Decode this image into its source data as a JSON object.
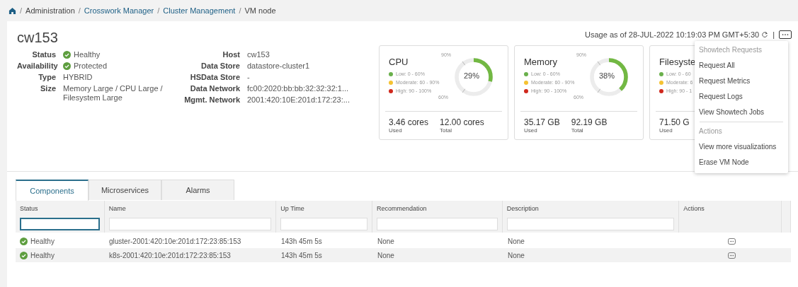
{
  "breadcrumb": [
    {
      "separator": "/",
      "label": "Administration",
      "kind": "text"
    },
    {
      "separator": "/",
      "label": "Crosswork Manager",
      "kind": "link"
    },
    {
      "separator": "/",
      "label": "Cluster Management",
      "kind": "link"
    },
    {
      "separator": "/",
      "label": "VM node",
      "kind": "text"
    }
  ],
  "title": "cw153",
  "usage": "Usage as of 28-JUL-2022 10:19:03 PM GMT+5:30",
  "separator": "|",
  "details_left": [
    {
      "label": "Status",
      "value": "Healthy",
      "kind": "status"
    },
    {
      "label": "Availability",
      "value": "Protected",
      "kind": "status"
    },
    {
      "label": "Type",
      "value": "HYBRID",
      "kind": "plain"
    },
    {
      "label": "Size",
      "value": "Memory Large / CPU Large / Filesystem Large",
      "kind": "plain"
    }
  ],
  "details_right": [
    {
      "label": "Host",
      "value": "cw153"
    },
    {
      "label": "Data Store",
      "value": "datastore-cluster1"
    },
    {
      "label": "HSData Store",
      "value": "-"
    },
    {
      "label": "Data Network",
      "value": "fc00:2020:bb:bb:32:32:32:1..."
    },
    {
      "label": "Mgmt. Network",
      "value": "2001:420:10E:201d:172:23:..."
    }
  ],
  "cards": [
    {
      "title": "CPU",
      "legend": [
        {
          "label": "Low: 0 - 60%",
          "color": "#6ab04c"
        },
        {
          "label": "Moderate: 60 - 90%",
          "color": "#f5c232"
        },
        {
          "label": "High: 90 - 100%",
          "color": "#d0281d"
        }
      ],
      "kind": "gauge",
      "level": 0.29,
      "percent": "29%",
      "tick_high": "90%",
      "tick_low": "60%",
      "used": "3.46 cores",
      "used_label": "Used",
      "total": "12.00 cores",
      "total_label": "Total"
    },
    {
      "title": "Memory",
      "legend": [
        {
          "label": "Low: 0 - 60%",
          "color": "#6ab04c"
        },
        {
          "label": "Moderate: 60 - 90%",
          "color": "#f5c232"
        },
        {
          "label": "High: 90 - 100%",
          "color": "#d0281d"
        }
      ],
      "kind": "gauge",
      "level": 0.38,
      "percent": "38%",
      "tick_high": "90%",
      "tick_low": "60%",
      "used": "35.17 GB",
      "used_label": "Used",
      "total": "92.19 GB",
      "total_label": "Total"
    },
    {
      "title": "Filesyste",
      "legend": [
        {
          "label": "Low: 0 - 60",
          "color": "#6ab04c"
        },
        {
          "label": "Moderate: 6",
          "color": "#f5c232"
        },
        {
          "label": "High: 90 - 1",
          "color": "#d0281d"
        }
      ],
      "kind": "partial",
      "used": "71.50 G",
      "used_label": "Used"
    }
  ],
  "menu": [
    {
      "kind": "header",
      "label": "Showtech Requests"
    },
    {
      "kind": "item",
      "label": "Request All"
    },
    {
      "kind": "item",
      "label": "Request Metrics"
    },
    {
      "kind": "item",
      "label": "Request Logs"
    },
    {
      "kind": "item",
      "label": "View Showtech Jobs"
    },
    {
      "kind": "divider"
    },
    {
      "kind": "header",
      "label": "Actions"
    },
    {
      "kind": "item",
      "label": "View more visualizations"
    },
    {
      "kind": "item",
      "label": "Erase VM Node"
    }
  ],
  "tabs": [
    {
      "label": "Components",
      "selected": true
    },
    {
      "label": "Microservices",
      "selected": false
    },
    {
      "label": "Alarms",
      "selected": false
    }
  ],
  "table": {
    "columns": [
      {
        "label": "Status",
        "kind": "filter",
        "focused": true
      },
      {
        "label": "Name",
        "kind": "filter",
        "focused": false
      },
      {
        "label": "Up Time",
        "kind": "filter",
        "focused": false
      },
      {
        "label": "Recommendation",
        "kind": "filter",
        "focused": false
      },
      {
        "label": "Description",
        "kind": "filter",
        "focused": false
      },
      {
        "label": "Actions",
        "kind": "plain"
      }
    ],
    "rows": [
      {
        "status": "Healthy",
        "name": "gluster-2001:420:10e:201d:172:23:85:153",
        "uptime": "143h 45m 5s",
        "recommendation": "None",
        "description": "None"
      },
      {
        "status": "Healthy",
        "name": "k8s-2001:420:10e:201d:172:23:85:153",
        "uptime": "143h 45m 5s",
        "recommendation": "None",
        "description": "None"
      }
    ]
  }
}
